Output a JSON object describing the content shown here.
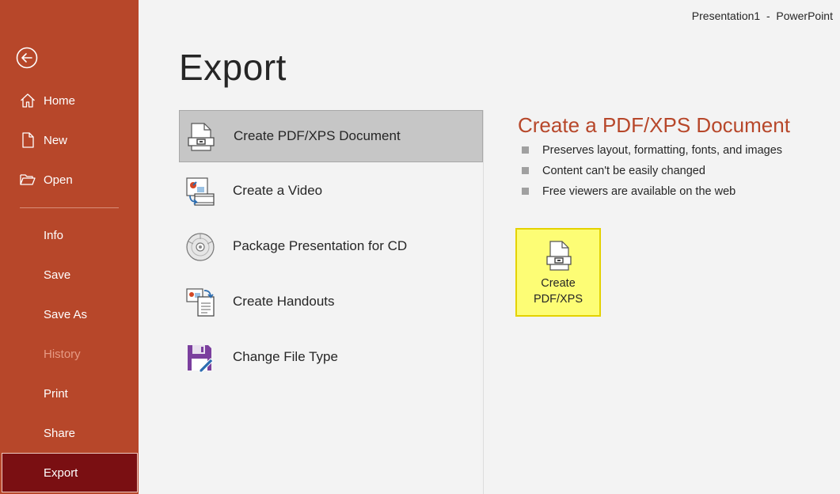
{
  "window": {
    "title": "Presentation1  -  PowerPoint"
  },
  "sidebar": {
    "back_icon": "back-arrow-icon",
    "top_items": [
      {
        "label": "Home",
        "icon": "home-icon"
      },
      {
        "label": "New",
        "icon": "new-document-icon"
      },
      {
        "label": "Open",
        "icon": "open-folder-icon"
      }
    ],
    "items": [
      {
        "label": "Info"
      },
      {
        "label": "Save"
      },
      {
        "label": "Save As"
      },
      {
        "label": "History",
        "disabled": true
      },
      {
        "label": "Print"
      },
      {
        "label": "Share"
      },
      {
        "label": "Export",
        "selected": true
      }
    ],
    "accent_color": "#b7472a",
    "selected_color": "#7a0f12"
  },
  "page": {
    "title": "Export"
  },
  "options": [
    {
      "label": "Create PDF/XPS Document",
      "icon": "pdf-document-icon",
      "selected": true
    },
    {
      "label": "Create a Video",
      "icon": "video-icon"
    },
    {
      "label": "Package Presentation for CD",
      "icon": "cd-icon"
    },
    {
      "label": "Create Handouts",
      "icon": "handouts-icon"
    },
    {
      "label": "Change File Type",
      "icon": "change-file-type-icon"
    }
  ],
  "details": {
    "title": "Create a PDF/XPS Document",
    "bullets": [
      "Preserves layout, formatting, fonts, and images",
      "Content can't be easily changed",
      "Free viewers are available on the web"
    ],
    "button_label": "Create\nPDF/XPS",
    "button_color": "#fdfd75"
  }
}
